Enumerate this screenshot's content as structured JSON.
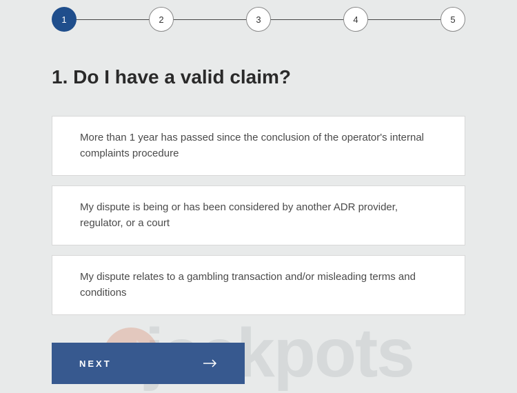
{
  "stepper": {
    "steps": [
      {
        "number": "1",
        "state": "active"
      },
      {
        "number": "2",
        "state": "inactive"
      },
      {
        "number": "3",
        "state": "inactive"
      },
      {
        "number": "4",
        "state": "inactive"
      },
      {
        "number": "5",
        "state": "inactive"
      }
    ]
  },
  "heading": "1. Do I have a valid claim?",
  "options": [
    {
      "text": "More than 1 year has passed since the conclusion of the operator's internal complaints procedure"
    },
    {
      "text": "My dispute is being or has been considered by another ADR provider, regulator, or a court"
    },
    {
      "text": "My dispute relates to a gambling transaction and/or misleading terms and conditions"
    }
  ],
  "next_button": {
    "label": "NEXT"
  },
  "watermark": {
    "text": "jackpots"
  }
}
